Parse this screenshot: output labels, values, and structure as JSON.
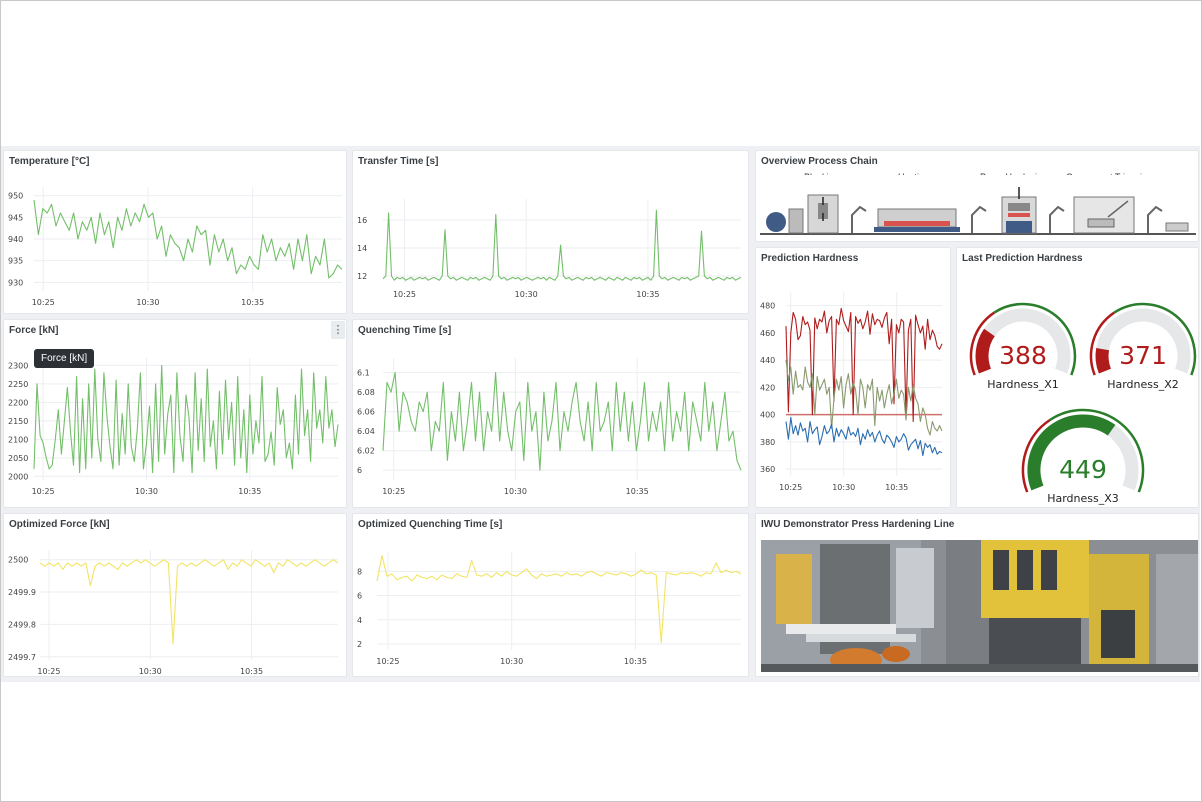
{
  "colors": {
    "green": "#73bf69",
    "yellow": "#f2e464",
    "red": "#b01c1c",
    "olive": "#8a9a6e",
    "blue": "#2a6db0",
    "threshold": "#d0706d"
  },
  "panels": {
    "temperature": {
      "title": "Temperature [°C]"
    },
    "transfer": {
      "title": "Transfer Time [s]"
    },
    "overview": {
      "title": "Overview Process Chain",
      "steps": [
        "Blanking",
        "Heating",
        "Press Hardening",
        "Component Trimming"
      ]
    },
    "force": {
      "title": "Force [kN]",
      "tooltip": "Force [kN]",
      "menu_icon": "⋮"
    },
    "quenching": {
      "title": "Quenching Time [s]"
    },
    "prediction": {
      "title": "Prediction Hardness"
    },
    "last_prediction": {
      "title": "Last Prediction Hardness"
    },
    "opt_force": {
      "title": "Optimized Force [kN]"
    },
    "opt_quench": {
      "title": "Optimized Quenching Time [s]"
    },
    "iwu": {
      "title": "IWU Demonstrator Press Hardening Line"
    }
  },
  "chart_data": [
    {
      "id": "temperature",
      "type": "line",
      "ylim": [
        928,
        952
      ],
      "yticks": [
        "950",
        "945",
        "940",
        "935",
        "930"
      ],
      "xticks": [
        "10:25",
        "10:30",
        "10:35"
      ],
      "series": [
        {
          "values": [
            949,
            941,
            947,
            946,
            948,
            943,
            946,
            944,
            942,
            946,
            940,
            944,
            942,
            945,
            939,
            946,
            941,
            944,
            938,
            945,
            942,
            947,
            943,
            946,
            944,
            948,
            945,
            946,
            940,
            943,
            936,
            941,
            939,
            938,
            935,
            940,
            937,
            943,
            941,
            942,
            934,
            941,
            937,
            940,
            935,
            938,
            932,
            934,
            933,
            936,
            934,
            933,
            941,
            937,
            940,
            935,
            938,
            936,
            939,
            933,
            940,
            935,
            941,
            932,
            936,
            934,
            940,
            931,
            932,
            934,
            933
          ]
        }
      ]
    },
    {
      "id": "transfer",
      "type": "line",
      "ylim": [
        11.5,
        17.5
      ],
      "yticks": [
        "16",
        "14",
        "12"
      ],
      "xticks": [
        "10:25",
        "10:30",
        "10:35"
      ],
      "series": [
        {
          "values": [
            11.8,
            12.0,
            16.5,
            12.0,
            11.7,
            11.9,
            11.8,
            11.9,
            11.7,
            11.8,
            11.9,
            11.7,
            11.8,
            11.9,
            11.8,
            11.9,
            11.7,
            11.8,
            11.9,
            11.8,
            11.7,
            12.0,
            15.3,
            12.0,
            11.8,
            11.9,
            11.7,
            11.8,
            11.9,
            11.8,
            11.7,
            11.9,
            11.8,
            11.9,
            11.7,
            11.8,
            11.9,
            11.8,
            11.7,
            12.0,
            16.4,
            12.0,
            11.8,
            11.9,
            11.7,
            11.8,
            11.9,
            11.8,
            11.9,
            11.7,
            11.8,
            11.9,
            11.8,
            11.7,
            11.8,
            11.9,
            11.8,
            11.9,
            11.7,
            11.9,
            11.8,
            11.7,
            12.0,
            14.2,
            12.0,
            11.8,
            11.9,
            11.7,
            11.8,
            11.9,
            11.8,
            11.7,
            11.9,
            11.8,
            11.9,
            11.7,
            11.8,
            11.9,
            11.8,
            11.7,
            11.9,
            11.8,
            11.7,
            11.9,
            11.8,
            11.7,
            11.9,
            11.8,
            11.7,
            11.9,
            11.8,
            11.9,
            11.7,
            11.8,
            11.9,
            11.7,
            12.0,
            16.7,
            12.0,
            11.8,
            11.9,
            11.7,
            11.8,
            11.9,
            11.8,
            11.7,
            11.9,
            11.8,
            11.9,
            11.7,
            11.8,
            11.9,
            12.0,
            15.2,
            12.0,
            11.8,
            11.9,
            11.7,
            11.8,
            11.9,
            11.8,
            11.7,
            11.9,
            11.8,
            11.9,
            11.7,
            11.8,
            11.9
          ]
        }
      ]
    },
    {
      "id": "force",
      "type": "line",
      "ylim": [
        1990,
        2320
      ],
      "yticks": [
        "2300",
        "2250",
        "2200",
        "2150",
        "2100",
        "2050",
        "2000"
      ],
      "xticks": [
        "10:25",
        "10:30",
        "10:35"
      ],
      "series": [
        {
          "values": [
            2020,
            2250,
            2110,
            2090,
            2050,
            2020,
            2030,
            2100,
            2180,
            2060,
            2150,
            2240,
            2120,
            2030,
            2270,
            2010,
            2210,
            2020,
            2250,
            2050,
            2290,
            2100,
            2040,
            2280,
            2160,
            2080,
            2020,
            2260,
            2030,
            2170,
            2060,
            2250,
            2080,
            2040,
            2130,
            2280,
            2020,
            2090,
            2190,
            2010,
            2250,
            2040,
            2300,
            2060,
            2170,
            2220,
            2010,
            2280,
            2110,
            2040,
            2220,
            2160,
            2010,
            2280,
            2070,
            2210,
            2040,
            2290,
            2080,
            2150,
            2020,
            2230,
            2060,
            2260,
            2100,
            2200,
            2030,
            2270,
            2050,
            2180,
            2010,
            2220,
            2060,
            2150,
            2090,
            2270,
            2040,
            2060,
            2120,
            2030,
            2240,
            2140,
            2180,
            2050,
            2090,
            2020,
            2220,
            2060,
            2290,
            2110,
            2180,
            2040,
            2280,
            2130,
            2180,
            2090,
            2270,
            2130,
            2180,
            2080,
            2140
          ]
        }
      ]
    },
    {
      "id": "quenching",
      "type": "line",
      "ylim": [
        5.99,
        6.115
      ],
      "yticks": [
        "6.1",
        "6.08",
        "6.06",
        "6.04",
        "6.02",
        "6"
      ],
      "xticks": [
        "10:25",
        "10:30",
        "10:35"
      ],
      "series": [
        {
          "values": [
            6.02,
            6.09,
            6.08,
            6.1,
            6.04,
            6.08,
            6.07,
            6.05,
            6.04,
            6.07,
            6.06,
            6.08,
            6.02,
            6.05,
            6.04,
            6.09,
            6.01,
            6.06,
            6.03,
            6.08,
            6.02,
            6.05,
            6.09,
            6.03,
            6.08,
            6.02,
            6.06,
            6.04,
            6.1,
            6.03,
            6.08,
            6.04,
            6.02,
            6.06,
            6.07,
            6.01,
            6.09,
            6.04,
            6.06,
            6.0,
            6.08,
            6.03,
            6.05,
            6.09,
            6.02,
            6.06,
            6.04,
            6.07,
            6.09,
            6.05,
            6.03,
            6.07,
            6.02,
            6.09,
            6.04,
            6.05,
            6.07,
            6.02,
            6.09,
            6.04,
            6.08,
            6.03,
            6.07,
            6.02,
            6.05,
            6.09,
            6.03,
            6.06,
            6.04,
            6.07,
            6.02,
            6.09,
            6.03,
            6.06,
            6.04,
            6.08,
            6.02,
            6.07,
            6.05,
            6.03,
            6.09,
            6.04,
            6.07,
            6.02,
            6.05,
            6.08,
            6.03,
            6.04,
            6.01,
            6.0
          ]
        }
      ]
    },
    {
      "id": "prediction",
      "type": "line",
      "ylim": [
        355,
        490
      ],
      "yticks": [
        "480",
        "460",
        "440",
        "420",
        "400",
        "380",
        "360"
      ],
      "xticks": [
        "10:25",
        "10:30",
        "10:35"
      ],
      "threshold": 400,
      "series": [
        {
          "name": "Hardness_X1",
          "color": "red",
          "values": [
            465,
            402,
            460,
            475,
            470,
            455,
            458,
            472,
            466,
            468,
            462,
            400,
            471,
            463,
            470,
            468,
            476,
            460,
            469,
            472,
            410,
            470,
            466,
            478,
            469,
            465,
            461,
            475,
            400,
            472,
            467,
            470,
            463,
            468,
            476,
            459,
            474,
            466,
            470,
            469,
            464,
            471,
            475,
            452,
            470,
            408,
            466,
            460,
            470,
            468,
            400,
            462,
            470,
            395,
            473,
            466,
            460,
            465,
            448,
            470,
            455,
            462,
            458,
            450,
            448,
            452
          ]
        },
        {
          "name": "Hardness_X2",
          "color": "olive",
          "values": [
            440,
            425,
            435,
            415,
            432,
            420,
            422,
            418,
            435,
            424,
            420,
            430,
            400,
            428,
            418,
            422,
            426,
            415,
            420,
            390,
            412,
            426,
            418,
            428,
            405,
            422,
            430,
            415,
            424,
            418,
            400,
            426,
            420,
            405,
            422,
            418,
            426,
            392,
            420,
            410,
            418,
            405,
            415,
            422,
            408,
            415,
            426,
            412,
            418,
            415,
            396,
            420,
            410,
            422,
            412,
            408,
            395,
            405,
            400,
            390,
            385,
            395,
            390,
            388,
            392,
            388
          ]
        },
        {
          "name": "Hardness_X3",
          "color": "blue",
          "values": [
            395,
            382,
            398,
            386,
            392,
            385,
            394,
            388,
            390,
            380,
            395,
            386,
            389,
            391,
            378,
            384,
            392,
            386,
            388,
            393,
            380,
            390,
            384,
            389,
            386,
            382,
            391,
            385,
            387,
            384,
            390,
            378,
            386,
            382,
            389,
            384,
            387,
            380,
            385,
            388,
            382,
            379,
            385,
            383,
            380,
            376,
            384,
            380,
            382,
            386,
            383,
            374,
            378,
            380,
            382,
            375,
            381,
            370,
            379,
            376,
            378,
            372,
            376,
            371,
            373,
            372
          ]
        }
      ]
    },
    {
      "id": "opt_force",
      "type": "line",
      "ylim": [
        2499.69,
        2500.03
      ],
      "yticks": [
        "2500",
        "2499.9",
        "2499.8",
        "2499.7"
      ],
      "xticks": [
        "10:25",
        "10:30",
        "10:35"
      ],
      "series": [
        {
          "values": [
            2499.99,
            2499.98,
            2499.99,
            2499.98,
            2499.99,
            2499.97,
            2499.99,
            2499.98,
            2499.99,
            2499.98,
            2499.99,
            2499.92,
            2499.98,
            2499.99,
            2499.98,
            2499.99,
            2499.98,
            2499.97,
            2499.99,
            2499.98,
            2499.99,
            2500.0,
            2499.99,
            2500.0,
            2499.99,
            2499.98,
            2499.99,
            2500.0,
            2499.99,
            2499.74,
            2499.98,
            2499.99,
            2499.98,
            2499.99,
            2499.98,
            2499.99,
            2500.0,
            2499.99,
            2499.98,
            2499.99,
            2500.0,
            2499.97,
            2499.99,
            2499.98,
            2500.0,
            2499.99,
            2499.98,
            2500.0,
            2499.99,
            2499.98,
            2499.99,
            2499.96,
            2499.99,
            2499.98,
            2500.0,
            2499.99,
            2499.98,
            2499.99,
            2499.98,
            2499.99,
            2500.0,
            2499.99,
            2499.98,
            2499.99,
            2500.0,
            2499.99
          ]
        }
      ]
    },
    {
      "id": "opt_quench",
      "type": "line",
      "ylim": [
        1.5,
        9.6
      ],
      "yticks": [
        "8",
        "6",
        "4",
        "2"
      ],
      "xticks": [
        "10:25",
        "10:30",
        "10:35"
      ],
      "series": [
        {
          "values": [
            7.2,
            9.3,
            7.6,
            7.8,
            7.3,
            7.5,
            7.6,
            7.2,
            7.7,
            7.5,
            7.4,
            7.6,
            7.3,
            7.7,
            7.5,
            7.4,
            7.8,
            7.6,
            7.5,
            8.9,
            7.7,
            7.6,
            7.8,
            7.5,
            7.9,
            7.6,
            8.0,
            7.7,
            7.6,
            7.9,
            8.2,
            7.7,
            7.4,
            7.8,
            7.6,
            7.7,
            7.8,
            7.6,
            7.9,
            7.7,
            7.8,
            7.6,
            7.9,
            8.0,
            7.8,
            7.6,
            7.9,
            7.8,
            7.7,
            7.9,
            7.8,
            7.6,
            7.8,
            8.1,
            7.8,
            7.9,
            7.7,
            2.1,
            7.9,
            7.8,
            7.7,
            7.9,
            7.8,
            7.9,
            7.8,
            7.6,
            7.9,
            7.8,
            8.7,
            7.9,
            8.1,
            7.9,
            8.0,
            7.8
          ]
        }
      ]
    }
  ],
  "gauges": [
    {
      "label": "Hardness_X1",
      "value": "388",
      "value_num": 388,
      "min": 350,
      "max": 500,
      "color": "#b01c1c"
    },
    {
      "label": "Hardness_X2",
      "value": "371",
      "value_num": 371,
      "min": 350,
      "max": 500,
      "color": "#b01c1c"
    },
    {
      "label": "Hardness_X3",
      "value": "449",
      "value_num": 449,
      "min": 350,
      "max": 500,
      "color": "#2a7d2a"
    }
  ]
}
